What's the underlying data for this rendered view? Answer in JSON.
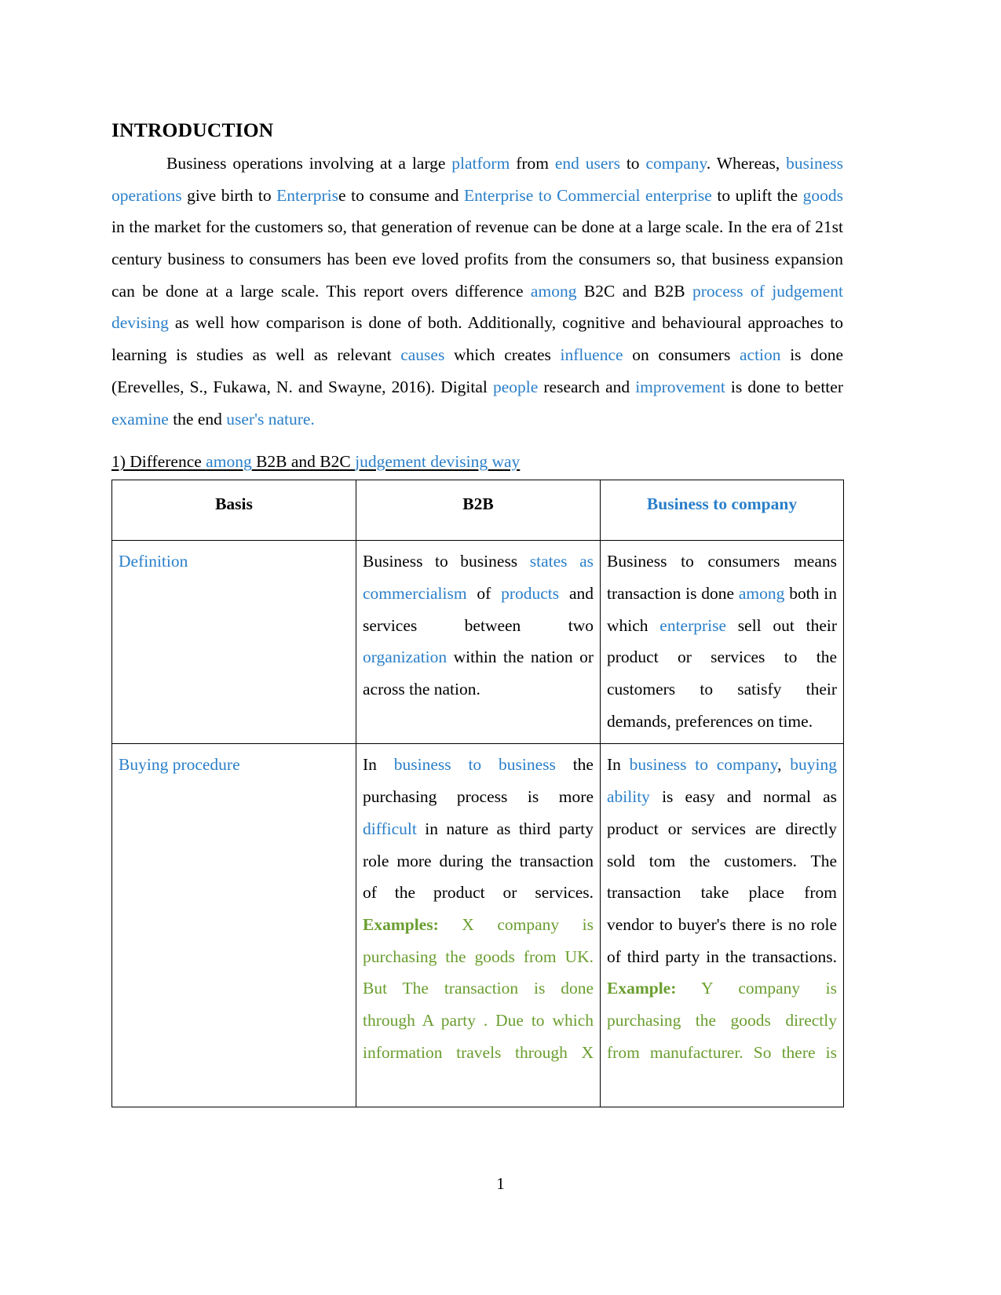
{
  "document": {
    "heading": "INTRODUCTION",
    "page_number": "1",
    "colors": {
      "link_blue": "#2a7fc9",
      "header_blue": "#1a6fc4",
      "example_green": "#6a9e2f",
      "text_black": "#000000"
    }
  },
  "intro_paragraph": {
    "segments": [
      {
        "text": "Business operations involving at a large ",
        "color": "black"
      },
      {
        "text": "platform",
        "color": "blue"
      },
      {
        "text": " from ",
        "color": "black"
      },
      {
        "text": "end users",
        "color": "blue"
      },
      {
        "text": " to ",
        "color": "black"
      },
      {
        "text": "company",
        "color": "blue"
      },
      {
        "text": ". Whereas, ",
        "color": "black"
      },
      {
        "text": "business operations",
        "color": "blue"
      },
      {
        "text": "  give birth to ",
        "color": "black"
      },
      {
        "text": "Enterpris",
        "color": "blue"
      },
      {
        "text": "e to consume and ",
        "color": "black"
      },
      {
        "text": "Enterprise to Commercial enterprise",
        "color": "blue"
      },
      {
        "text": " to uplift the ",
        "color": "black"
      },
      {
        "text": "goods",
        "color": "blue"
      },
      {
        "text": " in the market for the customers so, that generation of revenue can be done at a large scale. In the era of 21st century business to consumers has been eve loved profits from the consumers so, that business expansion can be done at a large scale. This report overs difference ",
        "color": "black"
      },
      {
        "text": "among",
        "color": "blue"
      },
      {
        "text": "  B2C and B2B  ",
        "color": "black"
      },
      {
        "text": "process of judgement devising",
        "color": "blue"
      },
      {
        "text": "  as well how comparison is done of both. Additionally, cognitive and behavioural approaches to learning is studies as well as relevant ",
        "color": "black"
      },
      {
        "text": "causes",
        "color": "blue"
      },
      {
        "text": " which creates ",
        "color": "black"
      },
      {
        "text": "influence",
        "color": "blue"
      },
      {
        "text": " on consumers ",
        "color": "black"
      },
      {
        "text": "action",
        "color": "blue"
      },
      {
        "text": " is done (Erevelles, S., Fukawa, N. and Swayne, 2016). Digital ",
        "color": "black"
      },
      {
        "text": "people",
        "color": "blue"
      },
      {
        "text": " research and ",
        "color": "black"
      },
      {
        "text": "improvement",
        "color": "blue"
      },
      {
        "text": " is done to better ",
        "color": "black"
      },
      {
        "text": "examine",
        "color": "blue"
      },
      {
        "text": " the end ",
        "color": "black"
      },
      {
        "text": "user's nature.",
        "color": "blue"
      }
    ]
  },
  "section_heading": {
    "segments": [
      {
        "text": "1) Difference ",
        "color": "black"
      },
      {
        "text": "among",
        "color": "blue"
      },
      {
        "text": " B2B and B2C ",
        "color": "black"
      },
      {
        "text": "judgement devising way",
        "color": "blue"
      }
    ]
  },
  "table": {
    "headers": [
      {
        "text": "Basis",
        "color": "black"
      },
      {
        "text": "B2B",
        "color": "black"
      },
      {
        "text": "Business to company",
        "color": "blue"
      }
    ],
    "rows": [
      {
        "basis": [
          {
            "text": "Definition",
            "color": "blue"
          }
        ],
        "b2b": [
          {
            "text": "Business to business ",
            "color": "black"
          },
          {
            "text": "states as commercialism",
            "color": "blue"
          },
          {
            "text": " of ",
            "color": "black"
          },
          {
            "text": "products",
            "color": "blue"
          },
          {
            "text": " and services between two ",
            "color": "black"
          },
          {
            "text": "organization",
            "color": "blue"
          },
          {
            "text": " within the nation or across the nation.",
            "color": "black"
          }
        ],
        "b2c": [
          {
            "text": "Business to consumers means transaction is done ",
            "color": "black"
          },
          {
            "text": "among",
            "color": "blue"
          },
          {
            "text": " both in which  ",
            "color": "black"
          },
          {
            "text": "enterprise",
            "color": "blue"
          },
          {
            "text": " sell out their product or services to the customers to satisfy their demands, preferences on time.",
            "color": "black"
          }
        ]
      },
      {
        "basis": [
          {
            "text": "Buying procedure",
            "color": "blue"
          }
        ],
        "b2b": [
          {
            "text": "In ",
            "color": "black"
          },
          {
            "text": "business to business",
            "color": "blue"
          },
          {
            "text": "  the purchasing process is more ",
            "color": "black"
          },
          {
            "text": "difficult",
            "color": "blue"
          },
          {
            "text": " in nature as third party role more during the transaction of the product or services. ",
            "color": "black"
          },
          {
            "text": "  Examples:",
            "color": "green",
            "bold": true
          },
          {
            "text": "  X company is purchasing the goods from UK. But The transaction is done through A party . Due to which information travels through X",
            "color": "green"
          }
        ],
        "b2c": [
          {
            "text": "In  ",
            "color": "black"
          },
          {
            "text": "business to company",
            "color": "blue"
          },
          {
            "text": ", ",
            "color": "black"
          },
          {
            "text": "buying ability",
            "color": "blue"
          },
          {
            "text": " is easy and normal as product or services are directly sold tom the customers. The  transaction take place from vendor to buyer's there is no role of third party in the transactions. ",
            "color": "black"
          },
          {
            "text": "Example:",
            "color": "green",
            "bold": true
          },
          {
            "text": "  Y company is purchasing the goods directly from manufacturer. So there is",
            "color": "green"
          }
        ]
      }
    ]
  }
}
